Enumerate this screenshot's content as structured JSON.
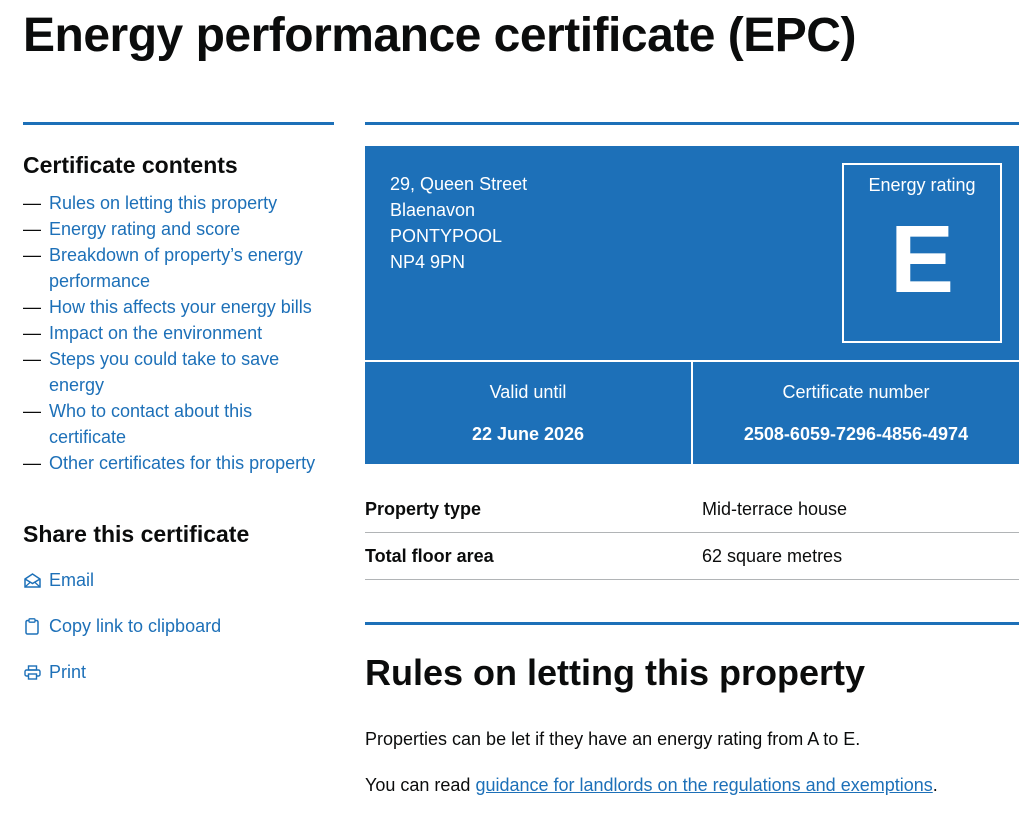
{
  "page": {
    "title": "Energy performance certificate (EPC)"
  },
  "sidebar": {
    "contents_title": "Certificate contents",
    "contents": [
      {
        "label": "Rules on letting this property"
      },
      {
        "label": "Energy rating and score"
      },
      {
        "label": "Breakdown of property’s energy performance"
      },
      {
        "label": "How this affects your energy bills"
      },
      {
        "label": "Impact on the environment"
      },
      {
        "label": "Steps you could take to save energy"
      },
      {
        "label": "Who to contact about this certificate"
      },
      {
        "label": "Other certificates for this property"
      }
    ],
    "dash": "—",
    "share_title": "Share this certificate",
    "share": [
      {
        "label": "Email",
        "icon": "envelope-icon"
      },
      {
        "label": "Copy link to clipboard",
        "icon": "clipboard-icon"
      },
      {
        "label": "Print",
        "icon": "printer-icon"
      }
    ]
  },
  "certificate": {
    "address": [
      "29, Queen Street",
      "Blaenavon",
      "PONTYPOOL",
      "NP4 9PN"
    ],
    "rating_label": "Energy rating",
    "rating": "E",
    "valid_until_label": "Valid until",
    "valid_until": "22 June 2026",
    "cert_number_label": "Certificate number",
    "cert_number": "2508-6059-7296-4856-4974"
  },
  "summary": [
    {
      "key": "Property type",
      "value": "Mid-terrace house"
    },
    {
      "key": "Total floor area",
      "value": "62 square metres"
    }
  ],
  "rules_section": {
    "title": "Rules on letting this property",
    "para1": "Properties can be let if they have an energy rating from A to E.",
    "para2_prefix": "You can read ",
    "para2_link": "guidance for landlords on the regulations and exemptions",
    "para2_suffix": "."
  },
  "colors": {
    "link": "#1d70b8",
    "panel": "#1d70b8",
    "text": "#0b0c0c",
    "border": "#b1b4b6"
  }
}
